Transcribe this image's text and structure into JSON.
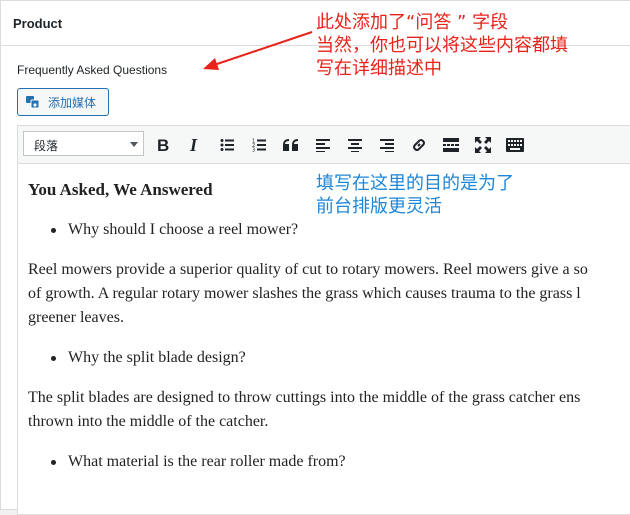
{
  "panel": {
    "title": "Product"
  },
  "field": {
    "label": "Frequently Asked Questions"
  },
  "media_button": {
    "label": "添加媒体"
  },
  "toolbar": {
    "format_select": "段落",
    "buttons": [
      "bold-icon",
      "italic-icon",
      "bullet-list-icon",
      "numbered-list-icon",
      "blockquote-icon",
      "align-left-icon",
      "align-center-icon",
      "align-right-icon",
      "link-icon",
      "read-more-icon",
      "fullscreen-icon",
      "toolbar-toggle-icon"
    ]
  },
  "content": {
    "heading": "You Asked, We Answered",
    "q1": "Why should I choose a reel mower?",
    "a1_line1": "Reel mowers provide a superior quality of cut to rotary mowers. Reel mowers give a so",
    "a1_line2": "of growth. A regular rotary mower slashes the grass which causes trauma to the grass l",
    "a1_line3": "greener leaves.",
    "q2": "Why the split blade design?",
    "a2_line1": "The split blades are designed to throw cuttings into the middle of the grass catcher ens",
    "a2_line2": "thrown into the middle of the catcher.",
    "q3": "What material is the rear roller made from?"
  },
  "annotations": {
    "red_line1": "此处添加了“问答 ” 字段",
    "red_line2": "当然，你也可以将这些内容都填",
    "red_line3": "写在详细描述中",
    "blue_line1": "填写在这里的目的是为了",
    "blue_line2": "前台排版更灵活"
  },
  "colors": {
    "accent": "#2271b1",
    "annotation_red": "#e8231a",
    "annotation_blue": "#1d86d6"
  }
}
